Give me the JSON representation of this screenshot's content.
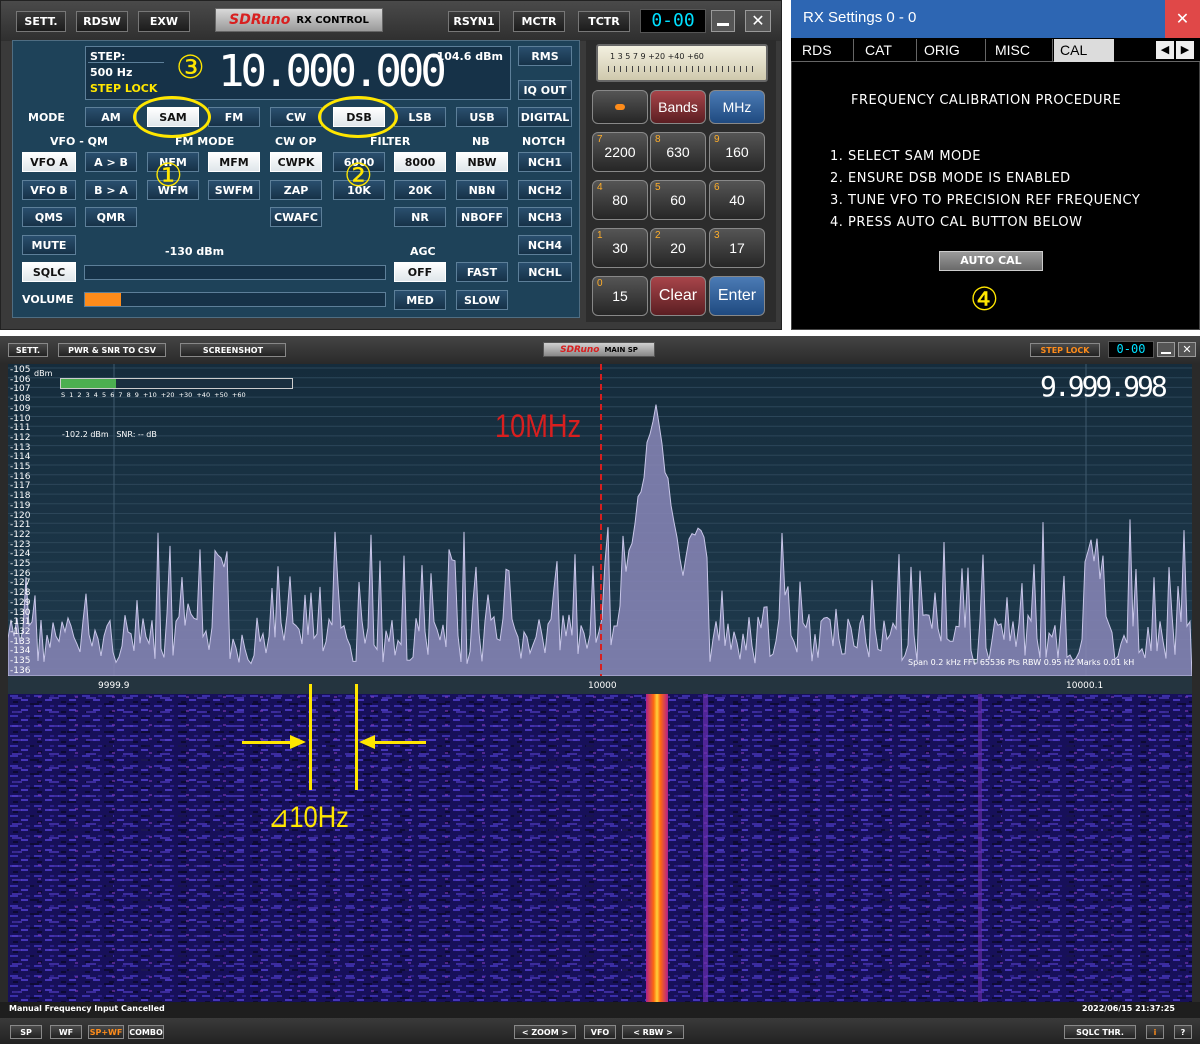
{
  "rx_control": {
    "title_logo": "SDRuno",
    "title": "RX CONTROL",
    "top_buttons": [
      "SETT.",
      "RDSW",
      "EXW",
      "RSYN1",
      "MCTR",
      "TCTR"
    ],
    "clock": "0-00",
    "step_label": "STEP:",
    "step_value": "500 Hz",
    "step_lock": "STEP LOCK",
    "frequency": "10.000.000",
    "signal_dbm": "-104.6 dBm",
    "squelch_dbm": "-130 dBm",
    "mode_label": "MODE",
    "modes": [
      "AM",
      "SAM",
      "FM",
      "CW",
      "DSB",
      "LSB",
      "USB",
      "DIGITAL"
    ],
    "section_labels": {
      "vfo": "VFO - QM",
      "fm_mode": "FM MODE",
      "cw_op": "CW OP",
      "filter": "FILTER",
      "nb": "NB",
      "notch": "NOTCH",
      "agc": "AGC"
    },
    "row1": [
      "VFO A",
      "A > B",
      "NFM",
      "MFM",
      "CWPK",
      "6000",
      "8000",
      "NBW",
      "NCH1"
    ],
    "row2": [
      "VFO B",
      "B > A",
      "WFM",
      "SWFM",
      "ZAP",
      "10K",
      "20K",
      "NBN",
      "NCH2"
    ],
    "row3": [
      "QMS",
      "QMR",
      "CWAFC",
      "NR",
      "NBOFF",
      "NCH3"
    ],
    "mute": "MUTE",
    "nch4": "NCH4",
    "sqlc": "SQLC",
    "agc_buttons": [
      "OFF",
      "FAST",
      "MED",
      "SLOW"
    ],
    "nchl": "NCHL",
    "volume": "VOLUME",
    "rms": "RMS",
    "iq_out": "IQ OUT",
    "meter_scale": "1 3 5 7 9 +20 +40 +60",
    "keypad_top": [
      "",
      "Bands",
      "MHz"
    ],
    "keypad": [
      {
        "big": "2200",
        "small": "7"
      },
      {
        "big": "630",
        "small": "8"
      },
      {
        "big": "160",
        "small": "9"
      },
      {
        "big": "80",
        "small": "4"
      },
      {
        "big": "60",
        "small": "5"
      },
      {
        "big": "40",
        "small": "6"
      },
      {
        "big": "30",
        "small": "1"
      },
      {
        "big": "20",
        "small": "2"
      },
      {
        "big": "17",
        "small": "3"
      },
      {
        "big": "15",
        "small": "0"
      },
      {
        "big": "Clear",
        "small": ""
      },
      {
        "big": "Enter",
        "small": ""
      }
    ],
    "annotations": [
      "③",
      "①",
      "②"
    ]
  },
  "rx_settings": {
    "title": "RX Settings 0 - 0",
    "close": "✕",
    "tabs": [
      "RDS",
      "CAT",
      "ORIG",
      "MISC",
      "CAL"
    ],
    "heading": "FREQUENCY CALIBRATION PROCEDURE",
    "steps": [
      "1. SELECT SAM MODE",
      "2. ENSURE DSB MODE IS ENABLED",
      "3. TUNE VFO TO PRECISION REF FREQUENCY",
      "4. PRESS AUTO CAL BUTTON BELOW"
    ],
    "auto_cal": "AUTO CAL",
    "annotation": "④"
  },
  "main_sp": {
    "buttons": [
      "SETT.",
      "PWR & SNR TO CSV",
      "SCREENSHOT"
    ],
    "logo": "SDRuno",
    "title": "MAIN SP",
    "step_lock": "STEP LOCK",
    "clock": "0-00",
    "dbm_unit": "dBm",
    "db_ticks": [
      "-105",
      "-106",
      "-107",
      "-108",
      "-109",
      "-110",
      "-111",
      "-112",
      "-113",
      "-114",
      "-115",
      "-116",
      "-117",
      "-118",
      "-119",
      "-120",
      "-121",
      "-122",
      "-123",
      "-124",
      "-125",
      "-126",
      "-127",
      "-128",
      "-129",
      "-130",
      "-131",
      "-132",
      "-133",
      "-134",
      "-135",
      "-136"
    ],
    "smeter_scale": "S 1 2 3 4 5 6 7 8 9 +10 +20 +30 +40 +50 +60",
    "smeter_level": 0.24,
    "readout": "-102.2 dBm   SNR: -- dB",
    "frequency": "9.999.998",
    "info": "Span 0.2 kHz  FFT 65536 Pts  RBW 0.95 Hz  Marks 0.01 kH",
    "freq_ticks": [
      "9999.9",
      "10000",
      "10000.1"
    ],
    "annotation_10mhz": "10MHz",
    "annotation_delta": "⊿10Hz",
    "status_left": "Manual Frequency Input Cancelled",
    "status_right": "2022/06/15 21:37:25",
    "bottom_left": [
      "SP",
      "WF",
      "SP+WF",
      "COMBO"
    ],
    "bottom_mid": [
      "< ZOOM >",
      "VFO",
      "< RBW >"
    ],
    "bottom_right": [
      "SQLC THR.",
      "i",
      "?"
    ]
  },
  "colors": {
    "panel": "#1e4259",
    "accent_yellow": "#ffe600",
    "marker_red": "#d81f1f",
    "spectrum_fill": "#8a87b8",
    "waterfall_bg": "#1a1460"
  }
}
